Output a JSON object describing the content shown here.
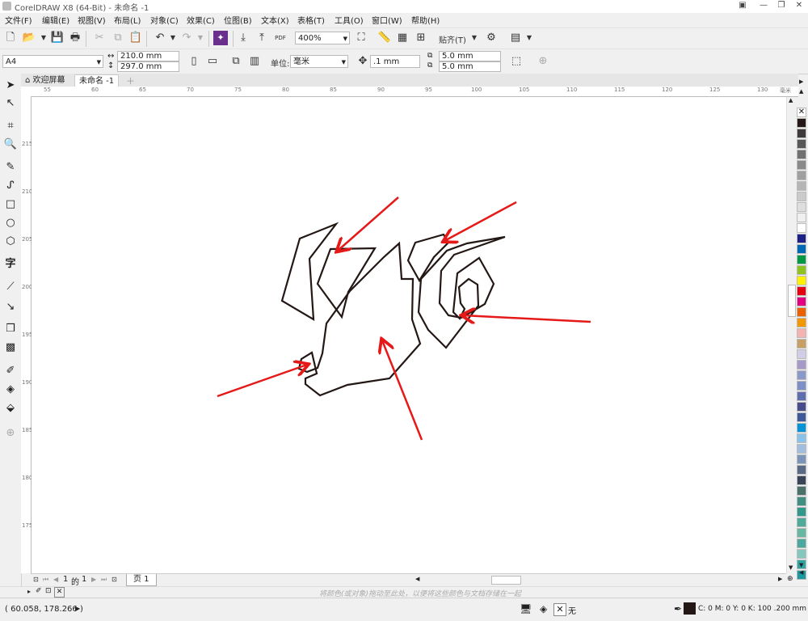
{
  "window": {
    "title": "CorelDRAW X8 (64-Bit) - 未命名 -1"
  },
  "menu": [
    "文件(F)",
    "编辑(E)",
    "视图(V)",
    "布局(L)",
    "对象(C)",
    "效果(C)",
    "位图(B)",
    "文本(X)",
    "表格(T)",
    "工具(O)",
    "窗口(W)",
    "帮助(H)"
  ],
  "toolbar": {
    "pdf_label": "PDF",
    "zoom": "400%",
    "snap_label": "贴齐(T)"
  },
  "propbar": {
    "paper": "A4",
    "width": "210.0 mm",
    "height": "297.0 mm",
    "units_label": "单位:",
    "units": "毫米",
    "nudge": ".1 mm",
    "dup_x": "5.0 mm",
    "dup_y": "5.0 mm"
  },
  "tabs": {
    "welcome": "欢迎屏幕",
    "doc": "未命名 -1"
  },
  "ruler": {
    "h_ticks": [
      "55",
      "60",
      "65",
      "70",
      "75",
      "80",
      "85",
      "90",
      "95",
      "100",
      "105",
      "110",
      "115",
      "120",
      "125",
      "130"
    ],
    "h_unit": "毫米",
    "v_ticks": [
      "215",
      "210",
      "205",
      "200",
      "195",
      "190",
      "185",
      "180",
      "175"
    ]
  },
  "pagenav": {
    "current": "1",
    "of": "的",
    "total": "1",
    "page_tab": "页 1"
  },
  "dock_hint": "将颜色(或对象)拖动至此处，以便将这些颜色与文档存储在一起",
  "status": {
    "coords": "( 60.058, 178.266 )",
    "fill": "无",
    "outline": "C: 0 M: 0 Y: 0 K: 100  .200 mm"
  },
  "palette": [
    "#231815",
    "#3e3a39",
    "#595757",
    "#727171",
    "#898989",
    "#9fa0a0",
    "#b5b5b6",
    "#c9caca",
    "#dcdddd",
    "#efefef",
    "#ffffff",
    "#1d2088",
    "#0068b7",
    "#009944",
    "#8fc31f",
    "#fff100",
    "#e60012",
    "#e4007f",
    "#eb6100",
    "#f39800",
    "#f5b2b2",
    "#c9a063",
    "#d2cde6",
    "#a59aca",
    "#8c97cb",
    "#7e8fc5",
    "#5f6eb0",
    "#474b8a",
    "#3c5a99",
    "#0095d9",
    "#89c3eb",
    "#a3bde0",
    "#7a95b9",
    "#5a6a86",
    "#394457",
    "#49706b",
    "#3f8f82",
    "#2f9a8b",
    "#4dab9a",
    "#67b8a3",
    "#4aa99d",
    "#84c7bd",
    "#2ca6a4",
    "#1a9aa0"
  ]
}
